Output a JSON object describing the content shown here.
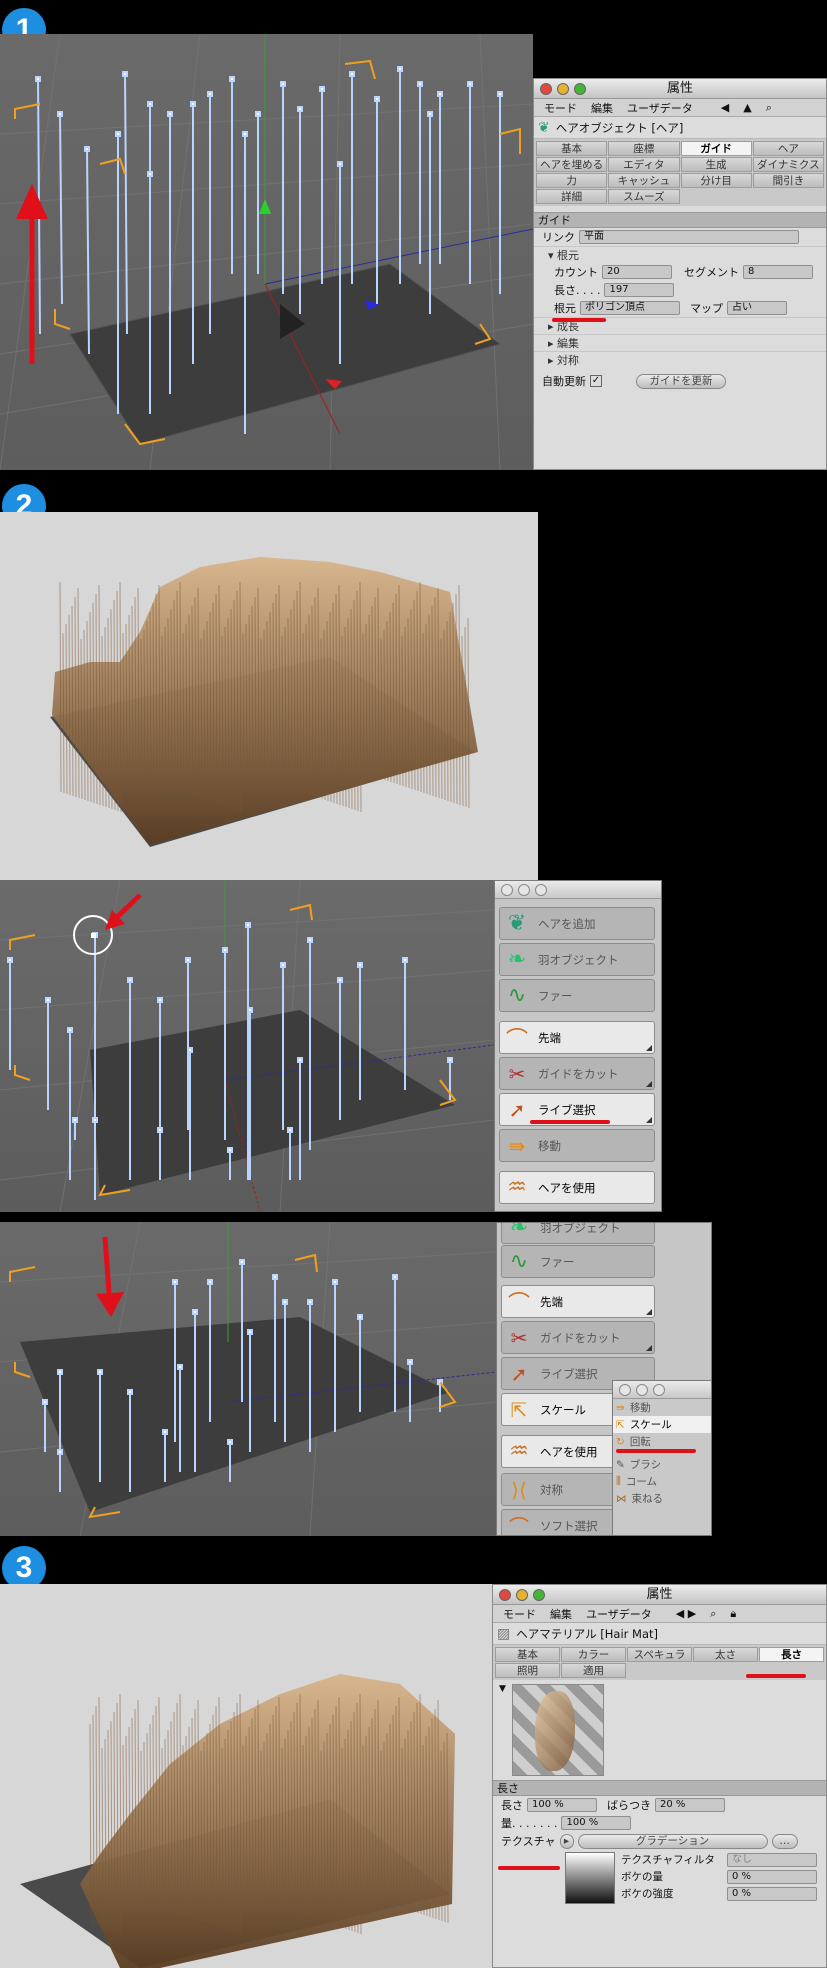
{
  "steps": [
    "1",
    "2",
    "3"
  ],
  "panel1": {
    "title": "属性",
    "menu": [
      "モード",
      "編集",
      "ユーザデータ"
    ],
    "object_name": "ヘアオブジェクト [ヘア]",
    "tabs": [
      "基本",
      "座標",
      "ガイド",
      "ヘア",
      "ヘアを埋める",
      "エディタ",
      "生成",
      "ダイナミクス",
      "力",
      "キャッシュ",
      "分け目",
      "間引き",
      "詳細",
      "スムーズ"
    ],
    "active_tab": "ガイド",
    "section": "ガイド",
    "link_label": "リンク",
    "link_value": "平面",
    "root_group": "根元",
    "count_label": "カウント",
    "count_value": "20",
    "segment_label": "セグメント",
    "segment_value": "8",
    "length_label": "長さ. . . .",
    "length_value": "197",
    "root_label": "根元",
    "root_value": "ポリゴン頂点",
    "map_label": "マップ",
    "map_value": "占い",
    "folds": [
      "成長",
      "編集",
      "対称"
    ],
    "auto_update_label": "自動更新",
    "update_button": "ガイドを更新"
  },
  "palette1": {
    "tools": [
      "ヘアを追加",
      "羽オブジェクト",
      "ファー",
      "先端",
      "ガイドをカット",
      "ライブ選択",
      "移動",
      "ヘアを使用"
    ]
  },
  "palette2": {
    "tools": [
      "羽オブジェクト",
      "ファー",
      "先端",
      "ガイドをカット",
      "ライブ選択",
      "スケール",
      "ヘアを使用",
      "対称",
      "ソフト選択"
    ]
  },
  "submenu": {
    "items": [
      "移動",
      "スケール",
      "回転",
      "ブラシ",
      "コーム",
      "束ねる"
    ]
  },
  "panel3": {
    "title": "属性",
    "menu": [
      "モード",
      "編集",
      "ユーザデータ"
    ],
    "object_name": "ヘアマテリアル [Hair Mat]",
    "tabs": [
      "基本",
      "カラー",
      "スペキュラ",
      "太さ",
      "長さ",
      "照明",
      "適用"
    ],
    "active_tab": "長さ",
    "section": "長さ",
    "length_label": "長さ",
    "length_value": "100 %",
    "variation_label": "ばらつき",
    "variation_value": "20 %",
    "amount_label": "量. . . . . . .",
    "amount_value": "100 %",
    "texture_label": "テクスチャ",
    "texture_value": "グラデーション",
    "filter_label": "テクスチャフィルタ",
    "filter_value": "なし",
    "blur_amount_label": "ボケの量",
    "blur_amount_value": "0 %",
    "blur_strength_label": "ボケの強度",
    "blur_strength_value": "0 %"
  },
  "colors": {
    "annotation_red": "#e0101a",
    "step_blue": "#1e8fe0",
    "guide_blue": "#b9d4ff",
    "selection_orange": "#f0a020",
    "hair_brown": "#a67a50"
  }
}
